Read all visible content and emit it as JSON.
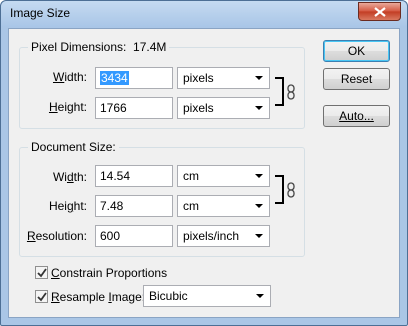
{
  "window": {
    "title": "Image Size"
  },
  "pixel_dimensions": {
    "legend": "Pixel Dimensions:",
    "size": "17.4M",
    "width": {
      "label": "Width:",
      "value": "3434",
      "unit": "pixels"
    },
    "height": {
      "label": "Height:",
      "value": "1766",
      "unit": "pixels"
    }
  },
  "document_size": {
    "legend": "Document Size:",
    "width": {
      "label": "Width:",
      "value": "14.54",
      "unit": "cm"
    },
    "height": {
      "label": "Height:",
      "value": "7.48",
      "unit": "cm"
    },
    "resolution": {
      "label": "Resolution:",
      "value": "600",
      "unit": "pixels/inch"
    }
  },
  "options": {
    "constrain": {
      "label": "Constrain Proportions",
      "checked": true
    },
    "resample": {
      "label": "Resample Image:",
      "checked": true,
      "method": "Bicubic"
    }
  },
  "buttons": {
    "ok": "OK",
    "reset": "Reset",
    "auto": "Auto..."
  }
}
